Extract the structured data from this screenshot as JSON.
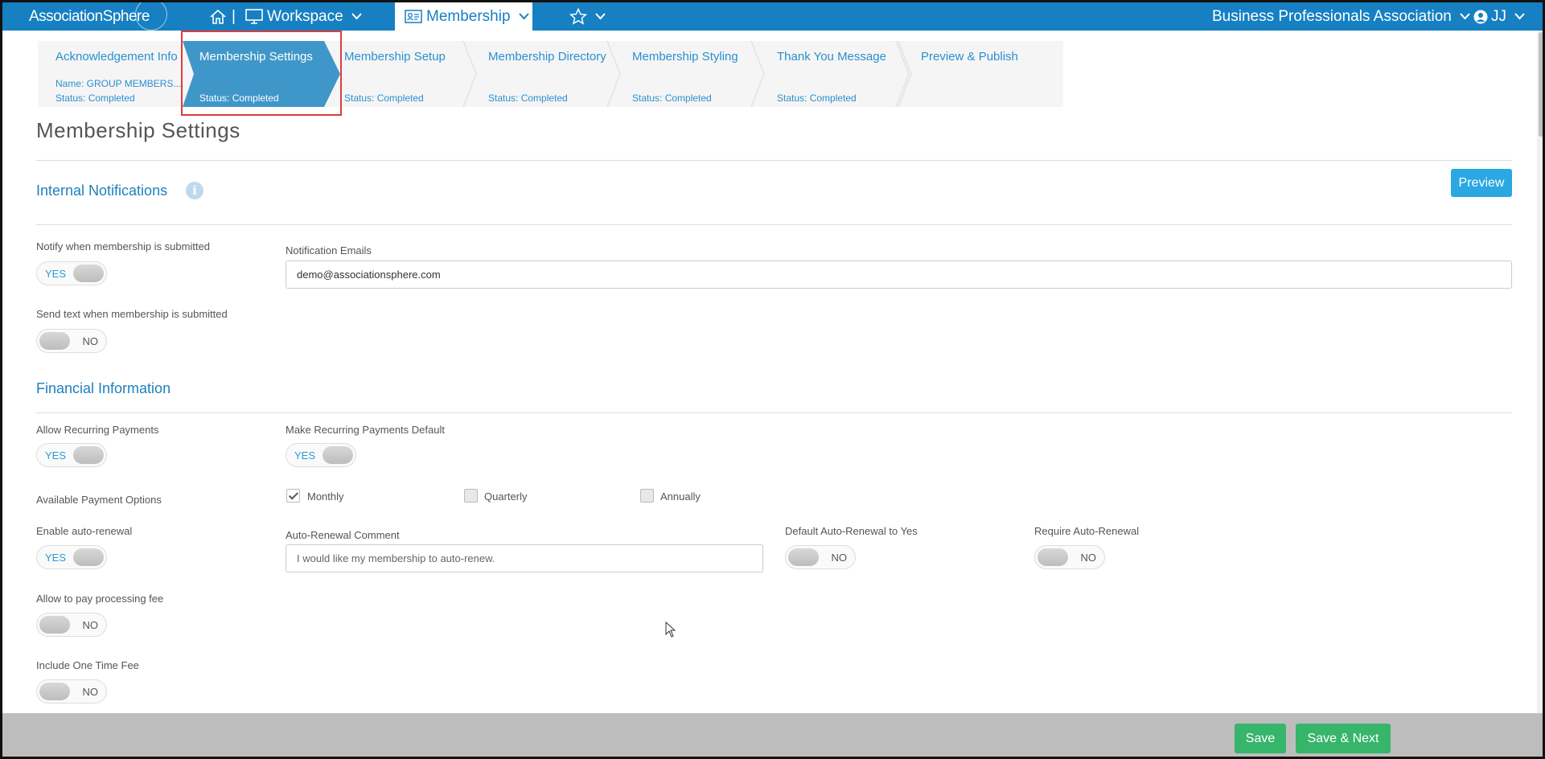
{
  "topbar": {
    "logo": "AssociationSphere",
    "workspace": "Workspace",
    "membership": "Membership",
    "organization": "Business Professionals Association",
    "user_initials": "JJ"
  },
  "wizard": {
    "steps": [
      {
        "title": "Acknowledgement Info",
        "name": "Name: GROUP MEMBERS...",
        "status": "Status: Completed"
      },
      {
        "title": "Membership Settings",
        "status": "Status: Completed"
      },
      {
        "title": "Membership Setup",
        "status": "Status: Completed"
      },
      {
        "title": "Membership Directory",
        "status": "Status: Completed"
      },
      {
        "title": "Membership Styling",
        "status": "Status: Completed"
      },
      {
        "title": "Thank You Message",
        "status": "Status: Completed"
      },
      {
        "title": "Preview & Publish"
      }
    ],
    "active_index": 1
  },
  "page": {
    "title": "Membership Settings"
  },
  "internal_notifications": {
    "heading": "Internal Notifications",
    "preview_label": "Preview",
    "notify_label": "Notify when membership is submitted",
    "notify_value": "YES",
    "emails_label": "Notification Emails",
    "emails_value": "demo@associationsphere.com",
    "text_label": "Send text when membership is submitted",
    "text_value": "NO"
  },
  "financial": {
    "heading": "Financial Information",
    "allow_recurring_label": "Allow Recurring Payments",
    "allow_recurring_value": "YES",
    "recurring_default_label": "Make Recurring Payments Default",
    "recurring_default_value": "YES",
    "payment_options_label": "Available Payment Options",
    "payment_options": [
      {
        "label": "Monthly",
        "checked": true
      },
      {
        "label": "Quarterly",
        "checked": false
      },
      {
        "label": "Annually",
        "checked": false
      }
    ],
    "auto_renewal_label": "Enable auto-renewal",
    "auto_renewal_value": "YES",
    "auto_renewal_comment_label": "Auto-Renewal Comment",
    "auto_renewal_comment_placeholder": "I would like my membership to auto-renew.",
    "default_auto_renewal_label": "Default Auto-Renewal to Yes",
    "default_auto_renewal_value": "NO",
    "require_auto_renewal_label": "Require Auto-Renewal",
    "require_auto_renewal_value": "NO",
    "processing_fee_label": "Allow to pay processing fee",
    "processing_fee_value": "NO",
    "one_time_fee_label": "Include One Time Fee",
    "one_time_fee_value": "NO"
  },
  "footer": {
    "save_label": "Save",
    "save_next_label": "Save & Next"
  },
  "colors": {
    "brand": "#1680c2",
    "accent": "#2ba7e1",
    "success": "#37b56b",
    "highlight": "#e03c3c"
  }
}
